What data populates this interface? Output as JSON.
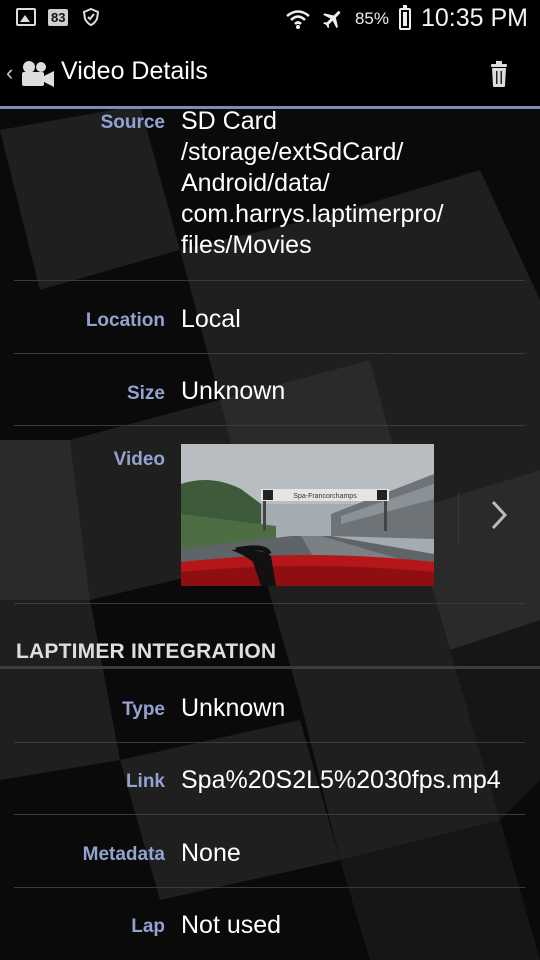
{
  "status_bar": {
    "notification_badge": "83",
    "battery_percent": "85%",
    "time": "10:35 PM",
    "icons": [
      "image-icon",
      "shield-icon",
      "wifi-icon",
      "airplane-icon",
      "battery-icon"
    ]
  },
  "action_bar": {
    "title": "Video Details",
    "back_icon": "chevron-left-icon",
    "app_icon": "video-camera-icon",
    "delete_icon": "trash-icon"
  },
  "details": [
    {
      "label": "Source",
      "value": "SD Card\n/storage/extSdCard/\nAndroid/data/\ncom.harrys.laptimerpro/\nfiles/Movies"
    },
    {
      "label": "Location",
      "value": "Local"
    },
    {
      "label": "Size",
      "value": "Unknown"
    },
    {
      "label": "Video",
      "thumbnail_caption": "Spa-Francorchamps"
    }
  ],
  "laptimer_section": {
    "header": "LAPTIMER INTEGRATION",
    "rows": [
      {
        "label": "Type",
        "value": "Unknown"
      },
      {
        "label": "Link",
        "value": "Spa%20S2L5%2030fps.mp4"
      },
      {
        "label": "Metadata",
        "value": "None"
      },
      {
        "label": "Lap",
        "value": "Not used"
      }
    ]
  },
  "colors": {
    "label": "#93a2cf",
    "accent_line": "#7e8bb6",
    "background": "#0b0b0b"
  }
}
